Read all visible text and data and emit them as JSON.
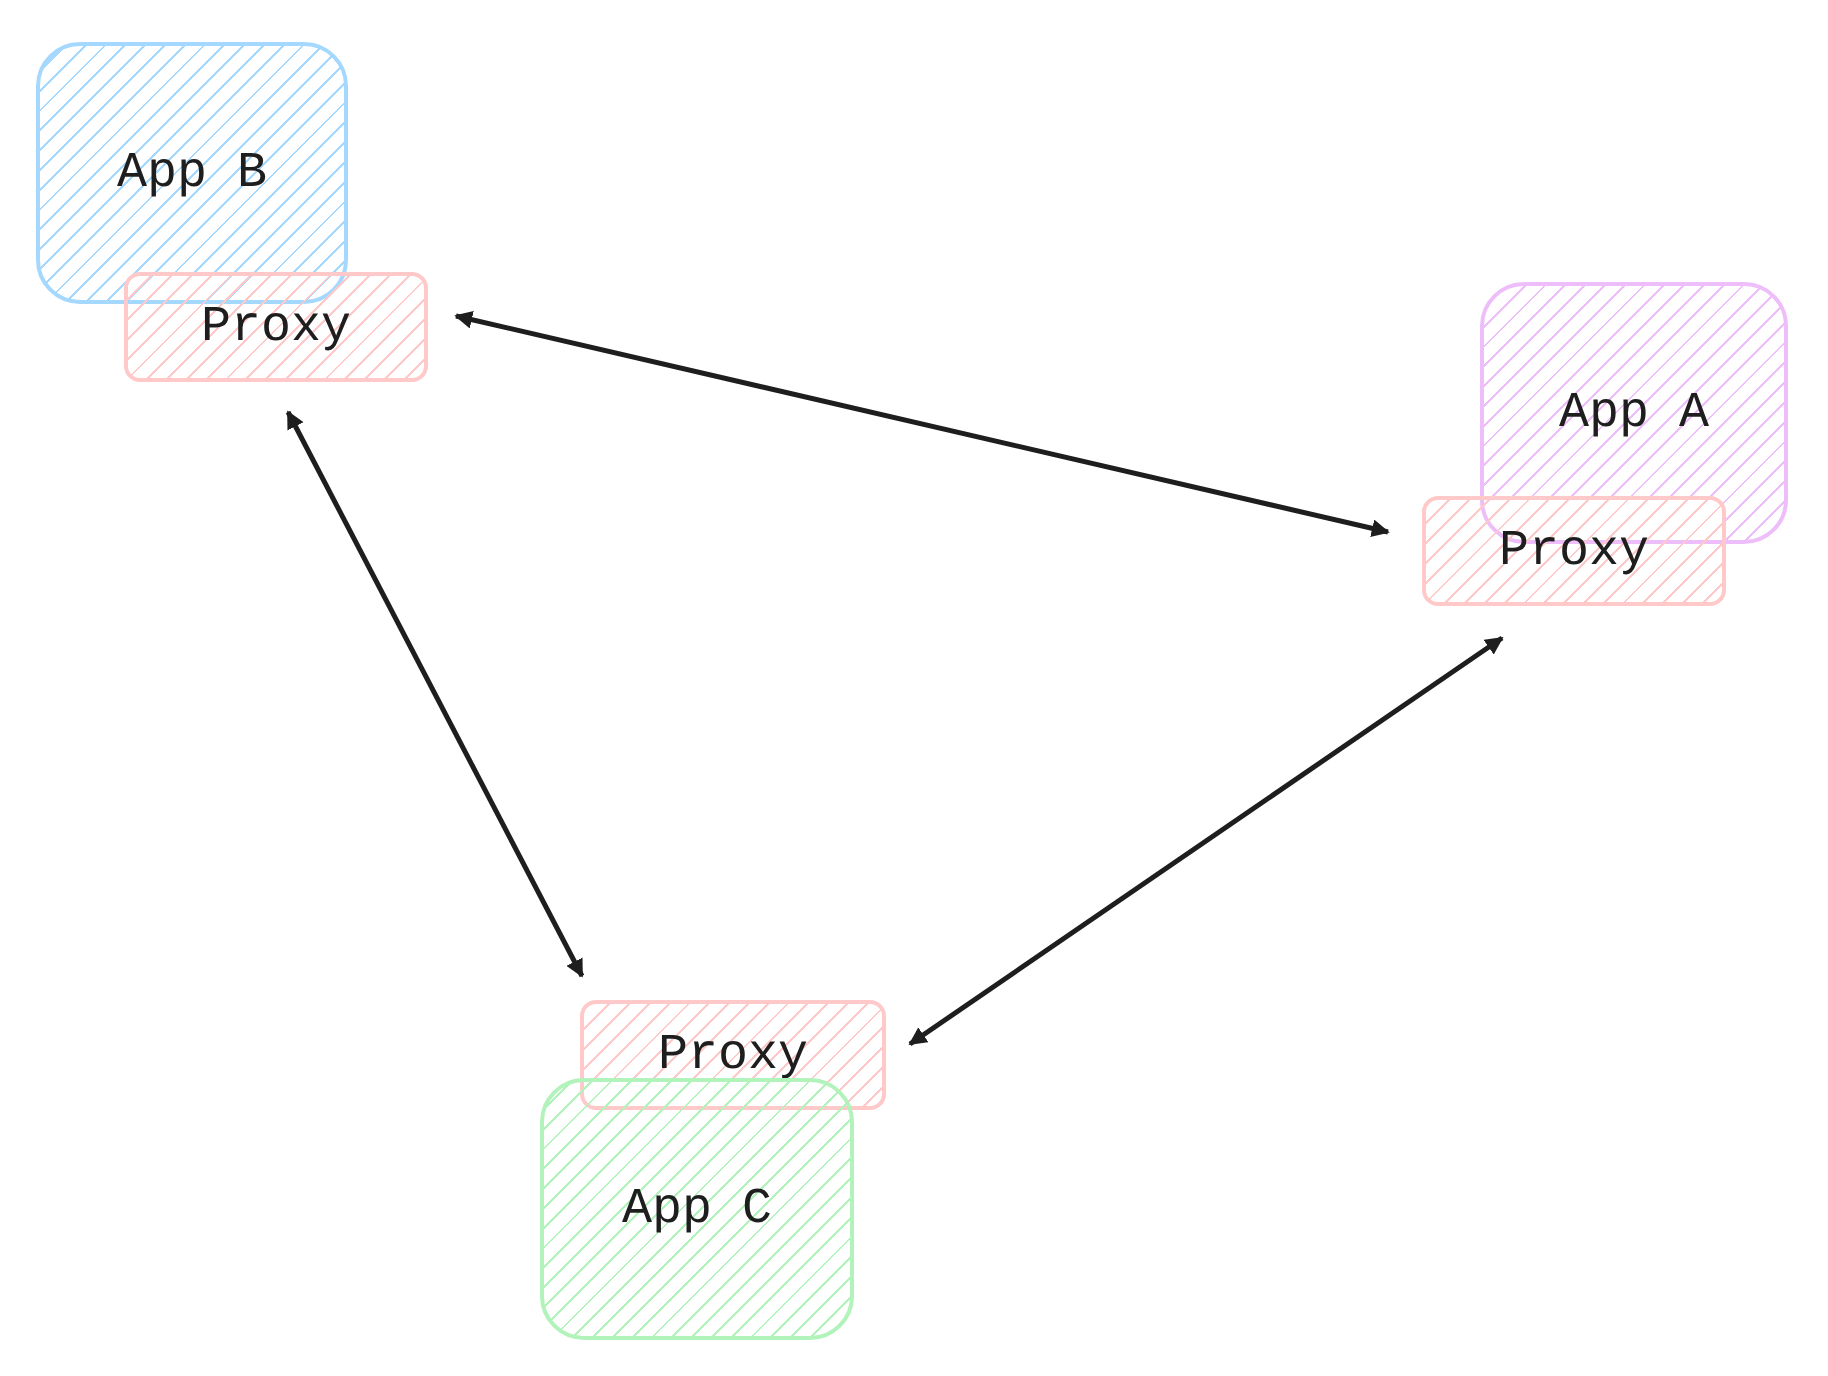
{
  "nodes": [
    {
      "kind": "app",
      "label": "App B",
      "color": "#a5d8ff"
    },
    {
      "kind": "proxy",
      "label": "Proxy",
      "color": "#ffc9c9"
    },
    {
      "kind": "app",
      "label": "App A",
      "color": "#eebefa"
    },
    {
      "kind": "proxy",
      "label": "Proxy",
      "color": "#ffc9c9"
    },
    {
      "kind": "proxy",
      "label": "Proxy",
      "color": "#ffc9c9"
    },
    {
      "kind": "app",
      "label": "App C",
      "color": "#b2f2bb"
    }
  ]
}
